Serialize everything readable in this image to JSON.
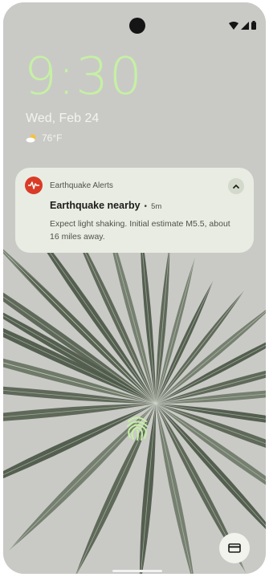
{
  "lockscreen": {
    "time": "9:30",
    "date": "Wed, Feb 24",
    "weather": {
      "icon": "partly-cloudy-icon",
      "temperature": "76°F"
    }
  },
  "notification": {
    "app_name": "Earthquake Alerts",
    "app_icon": "earthquake-alert-icon",
    "title": "Earthquake nearby",
    "separator": "•",
    "time": "5m",
    "body": "Expect light shaking. Initial estimate M5.5, about 16 miles away."
  },
  "status_bar": {
    "icons": [
      "wifi-icon",
      "signal-icon",
      "battery-icon"
    ]
  },
  "colors": {
    "clock": "#c6f0a4",
    "alert_red": "#d93b26",
    "card": "#e9ece3"
  }
}
